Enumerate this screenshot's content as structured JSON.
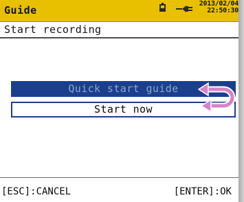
{
  "header": {
    "title": "Guide",
    "date": "2013/02/04",
    "time": "22:50:30",
    "battery_icon": "battery-icon",
    "power_icon": "ac-plug-icon",
    "accent_color": "#e8c000"
  },
  "subheader": {
    "title": "Start recording"
  },
  "menu": {
    "items": [
      {
        "label": "Quick start guide",
        "selected": true
      },
      {
        "label": "Start now",
        "selected": false
      }
    ],
    "selection_color": "#1b3f8c",
    "cycle_indicator_icon": "cycle-arrow-icon",
    "cycle_indicator_color": "#d682c8"
  },
  "footer": {
    "cancel_label": "[ESC]:CANCEL",
    "ok_label": "[ENTER]:OK"
  }
}
